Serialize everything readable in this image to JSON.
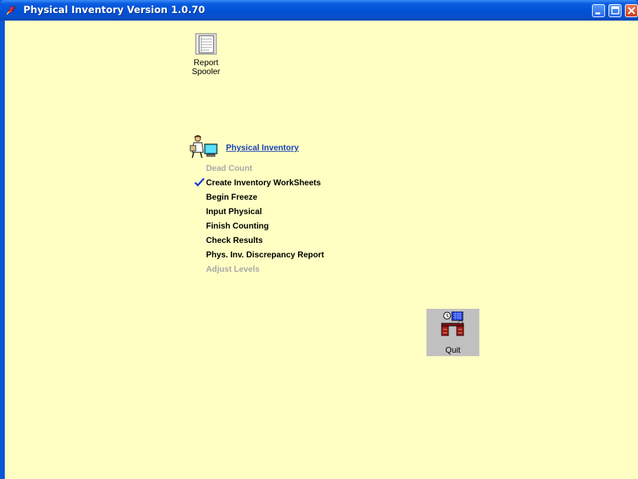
{
  "window": {
    "title": "Physical Inventory Version 1.0.70"
  },
  "toolbar": {
    "report_spooler_label": "Report\nSpooler"
  },
  "section": {
    "title": "Physical Inventory",
    "items": [
      {
        "label": "Dead Count",
        "enabled": false,
        "checked": false
      },
      {
        "label": "Create Inventory WorkSheets",
        "enabled": true,
        "checked": true
      },
      {
        "label": "Begin Freeze",
        "enabled": true,
        "checked": false
      },
      {
        "label": "Input Physical",
        "enabled": true,
        "checked": false
      },
      {
        "label": "Finish Counting",
        "enabled": true,
        "checked": false
      },
      {
        "label": "Check Results",
        "enabled": true,
        "checked": false
      },
      {
        "label": "Phys. Inv. Discrepancy Report",
        "enabled": true,
        "checked": false
      },
      {
        "label": "Adjust Levels",
        "enabled": false,
        "checked": false
      }
    ]
  },
  "quit": {
    "label": "Quit"
  },
  "colors": {
    "client_background": "#ffffc4",
    "link": "#1a44b4",
    "disabled_text": "#a8a8a8",
    "check": "#1c3fd8",
    "titlebar": "#0052d6"
  }
}
